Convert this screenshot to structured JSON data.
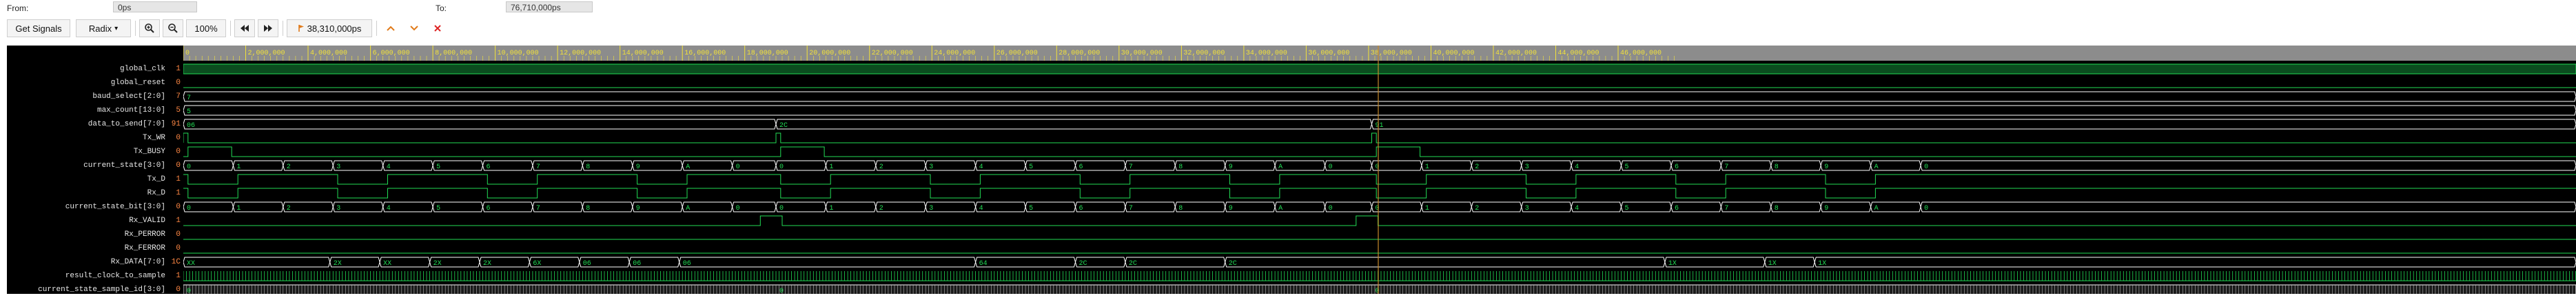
{
  "header": {
    "from_label": "From:",
    "from_value": "0ps",
    "to_label": "To:",
    "to_value": "76,710,000ps"
  },
  "toolbar": {
    "get_signals_label": "Get Signals",
    "radix_label": "Radix",
    "radix_caret": "▾",
    "zoom_in_icon": "zoom-in-icon",
    "zoom_out_icon": "zoom-out-icon",
    "zoom_value": "100%",
    "first_icon": "skip-back-icon",
    "last_icon": "skip-forward-icon",
    "cursor_time": "38,310,000ps",
    "prev_icon": "chevron-up-icon",
    "next_icon": "chevron-down-icon",
    "close_icon": "close-icon",
    "accent": "#e07a1a",
    "red": "#dd2222"
  },
  "colors": {
    "wave": "#22dd55",
    "bus": "#ffffff",
    "ruler_bg": "#8c8c8c",
    "ruler_text": "#f2e23a",
    "cursor": "#c88a2a"
  },
  "timeline": {
    "max_ps": 76710000,
    "cursor_ps": 38310000,
    "tick_labels": [
      "0",
      "2,000,000",
      "4,000,000",
      "6,000,000",
      "8,000,000",
      "10,000,000",
      "12,000,000",
      "14,000,000",
      "16,000,000",
      "18,000,000",
      "20,000,000",
      "22,000,000",
      "24,000,000",
      "26,000,000",
      "28,000,000",
      "30,000,000",
      "32,000,000",
      "34,000,000",
      "36,000,000",
      "38,000,000",
      "40,000,000",
      "42,000,000",
      "44,000,000",
      "46,000,000"
    ]
  },
  "signals": [
    {
      "name": "global_clk",
      "value": "1"
    },
    {
      "name": "global_reset",
      "value": "0"
    },
    {
      "name": "baud_select[2:0]",
      "value": "7"
    },
    {
      "name": "max_count[13:0]",
      "value": "5"
    },
    {
      "name": "data_to_send[7:0]",
      "value": "91"
    },
    {
      "name": "Tx_WR",
      "value": "0"
    },
    {
      "name": "Tx_BUSY",
      "value": "0"
    },
    {
      "name": "current_state[3:0]",
      "value": "0"
    },
    {
      "name": "Tx_D",
      "value": "1"
    },
    {
      "name": "Rx_D",
      "value": "1"
    },
    {
      "name": "current_state_bit[3:0]",
      "value": "0"
    },
    {
      "name": "Rx_VALID",
      "value": "1"
    },
    {
      "name": "Rx_PERROR",
      "value": "0"
    },
    {
      "name": "Rx_FERROR",
      "value": "0"
    },
    {
      "name": "Rx_DATA[7:0]",
      "value": "1C"
    },
    {
      "name": "result_clock_to_sample",
      "value": "1"
    },
    {
      "name": "current_state_sample_id[3:0]",
      "value": "0"
    }
  ],
  "waves": {
    "baud_select_text": "7",
    "max_count_text": "5",
    "data_to_send": [
      {
        "t": 0,
        "v": "06"
      },
      {
        "t": 19000000,
        "v": "2C"
      },
      {
        "t": 38100000,
        "v": "91"
      }
    ],
    "state_counter": [
      "0",
      "1",
      "2",
      "3",
      "4",
      "5",
      "6",
      "7",
      "8",
      "9",
      "A",
      "0"
    ],
    "frames_start_ps": [
      0,
      19000000,
      38100000
    ],
    "frame_period_ps": 1600000,
    "rx_data": [
      {
        "t": 0,
        "v": "XX"
      },
      {
        "t": 4700000,
        "v": "2X"
      },
      {
        "t": 6300000,
        "v": "XX"
      },
      {
        "t": 7900000,
        "v": "2X"
      },
      {
        "t": 9500000,
        "v": "2X"
      },
      {
        "t": 11100000,
        "v": "6X"
      },
      {
        "t": 12700000,
        "v": "06"
      },
      {
        "t": 14300000,
        "v": "06"
      },
      {
        "t": 15900000,
        "v": "06"
      },
      {
        "t": 25400000,
        "v": "64"
      },
      {
        "t": 28600000,
        "v": "2C"
      },
      {
        "t": 30200000,
        "v": "2C"
      },
      {
        "t": 33400000,
        "v": "2C"
      },
      {
        "t": 47500000,
        "v": "1X"
      },
      {
        "t": 50700000,
        "v": "1X"
      },
      {
        "t": 52300000,
        "v": "1X"
      }
    ]
  }
}
